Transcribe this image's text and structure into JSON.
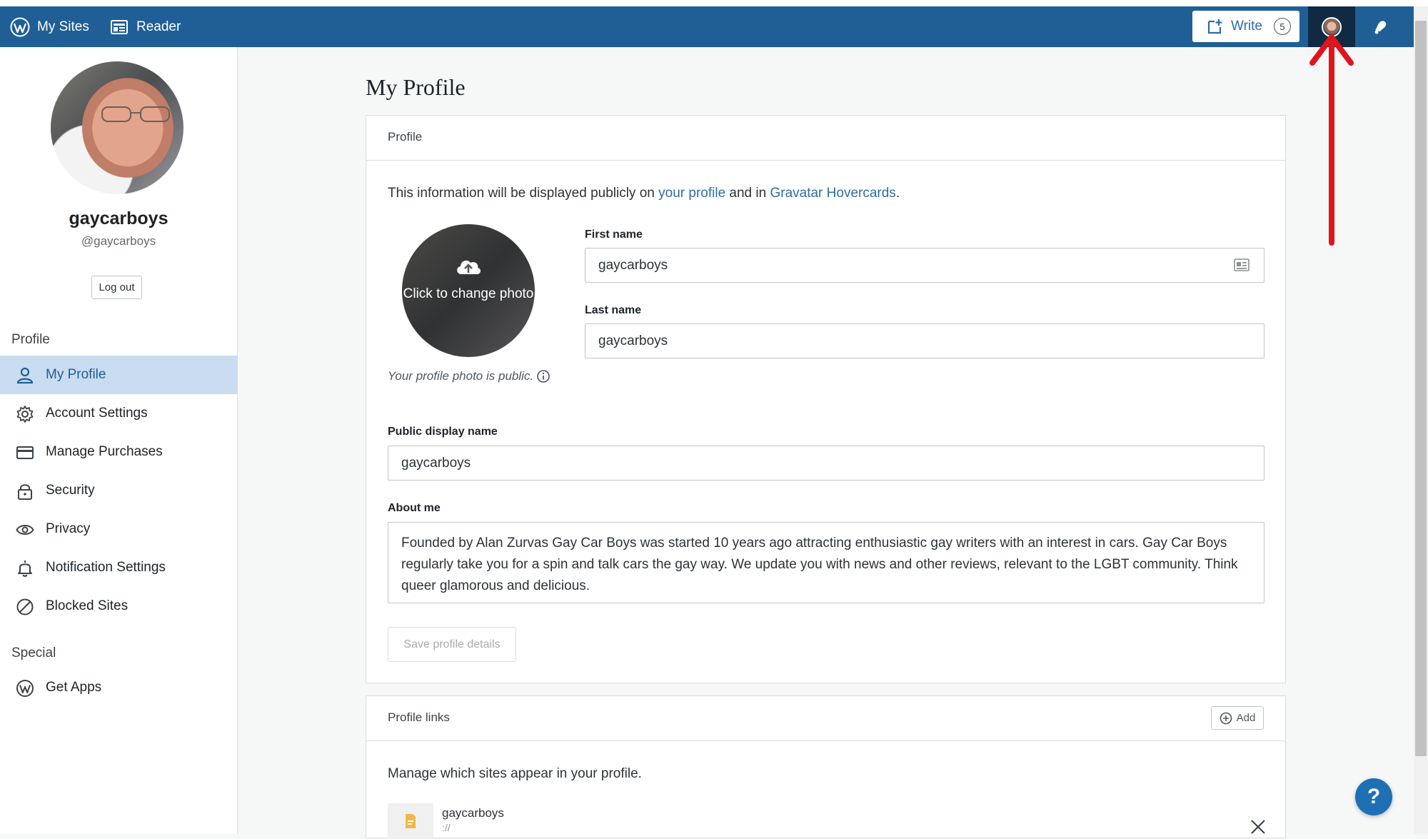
{
  "masterbar": {
    "my_sites": "My Sites",
    "reader": "Reader",
    "write": "Write",
    "write_count": "5"
  },
  "sidebar": {
    "name": "gaycarboys",
    "handle": "@gaycarboys",
    "logout": "Log out",
    "section_profile": "Profile",
    "section_special": "Special",
    "items": [
      {
        "label": "My Profile",
        "icon": "user-icon",
        "active": true
      },
      {
        "label": "Account Settings",
        "icon": "gear-icon"
      },
      {
        "label": "Manage Purchases",
        "icon": "credit-card-icon"
      },
      {
        "label": "Security",
        "icon": "lock-icon"
      },
      {
        "label": "Privacy",
        "icon": "eye-icon"
      },
      {
        "label": "Notification Settings",
        "icon": "bell-icon"
      },
      {
        "label": "Blocked Sites",
        "icon": "blocked-icon"
      }
    ],
    "special_items": [
      {
        "label": "Get Apps",
        "icon": "wordpress-icon"
      }
    ]
  },
  "main": {
    "title": "My Profile",
    "profile_card": {
      "header": "Profile",
      "intro_prefix": "This information will be displayed publicly on ",
      "intro_link1": "your profile",
      "intro_mid": " and in ",
      "intro_link2": "Gravatar Hovercards",
      "intro_suffix": ".",
      "photo_cta": "Click to change photo",
      "photo_note": "Your profile photo is public.",
      "first_name_label": "First name",
      "first_name_value": "gaycarboys",
      "last_name_label": "Last name",
      "last_name_value": "gaycarboys",
      "display_name_label": "Public display name",
      "display_name_value": "gaycarboys",
      "about_label": "About me",
      "about_value": "Founded by Alan Zurvas Gay Car Boys was started 10 years ago attracting enthusiastic gay writers with an interest in cars. Gay Car Boys regularly take you for a spin and talk cars the gay way. We update you with news and other reviews, relevant to the LGBT community. Think queer glamorous and delicious.",
      "save_label": "Save profile details"
    },
    "links_card": {
      "header": "Profile links",
      "add_label": "Add",
      "description": "Manage which sites appear in your profile.",
      "links": [
        {
          "name": "gaycarboys",
          "url": "://"
        }
      ]
    }
  },
  "help": {
    "label": "?"
  },
  "colors": {
    "masterbar": "#1f5f96",
    "accent": "#2c6ea3",
    "active_bg": "#c9dcf0",
    "annotation_arrow": "#e0151b"
  }
}
